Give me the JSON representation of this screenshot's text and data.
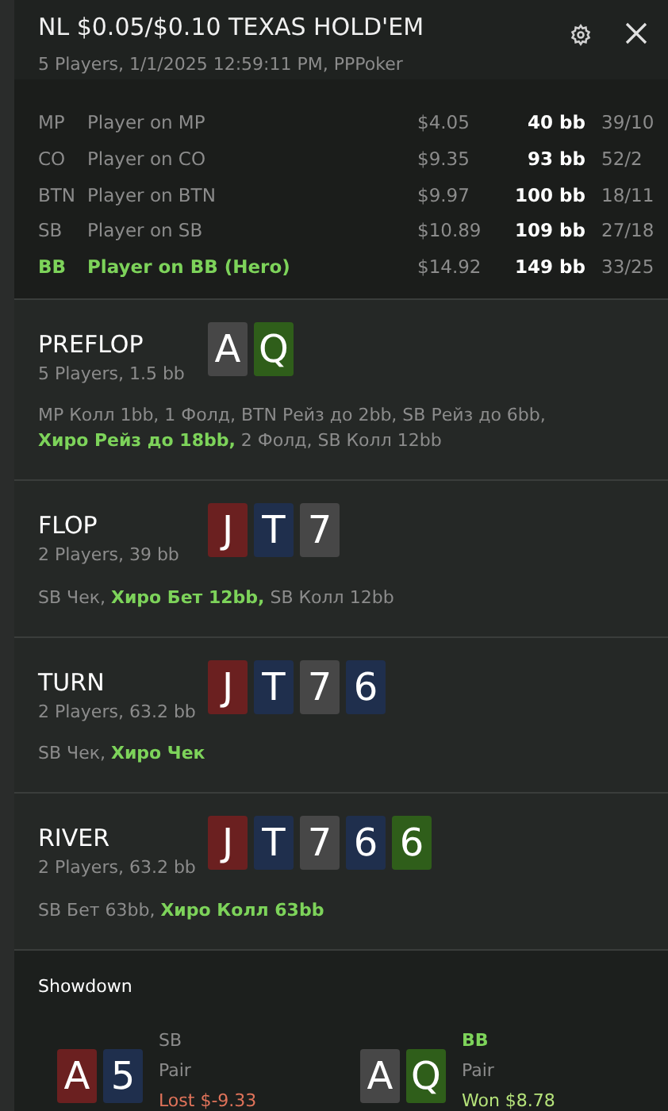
{
  "header": {
    "title": "NL $0.05/$0.10 TEXAS HOLD'EM",
    "subtitle": "5 Players, 1/1/2025 12:59:11 PM, PPPoker"
  },
  "players": [
    {
      "position": "MP",
      "name": "Player on MP",
      "stack": "$4.05",
      "bb": "40 bb",
      "stats": "39/10",
      "hero": false
    },
    {
      "position": "CO",
      "name": "Player on CO",
      "stack": "$9.35",
      "bb": "93 bb",
      "stats": "52/2",
      "hero": false
    },
    {
      "position": "BTN",
      "name": "Player on BTN",
      "stack": "$9.97",
      "bb": "100 bb",
      "stats": "18/11",
      "hero": false
    },
    {
      "position": "SB",
      "name": "Player on SB",
      "stack": "$10.89",
      "bb": "109 bb",
      "stats": "27/18",
      "hero": false
    },
    {
      "position": "BB",
      "name": "Player on BB (Hero)",
      "stack": "$14.92",
      "bb": "149 bb",
      "stats": "33/25",
      "hero": true
    }
  ],
  "streets": [
    {
      "name": "PREFLOP",
      "info": "5 Players, 1.5 bb",
      "cards": [
        {
          "rank": "A",
          "color": "#474747"
        },
        {
          "rank": "Q",
          "color": "#2f5e1a"
        }
      ],
      "actions": [
        {
          "text": "MP Колл 1bb, 1 Фолд, BTN Рейз до 2bb, SB Рейз до 6bb, ",
          "hero": false
        },
        {
          "text": "Хиро Рейз до 18bb,",
          "hero": true
        },
        {
          "text": " 2 Фолд, SB Колл 12bb",
          "hero": false
        }
      ]
    },
    {
      "name": "FLOP",
      "info": "2 Players, 39 bb",
      "cards": [
        {
          "rank": "J",
          "color": "#6b2020"
        },
        {
          "rank": "T",
          "color": "#1f2f4d"
        },
        {
          "rank": "7",
          "color": "#474747"
        }
      ],
      "actions": [
        {
          "text": "SB Чек, ",
          "hero": false
        },
        {
          "text": "Хиро Бет 12bb,",
          "hero": true
        },
        {
          "text": " SB Колл 12bb",
          "hero": false
        }
      ]
    },
    {
      "name": "TURN",
      "info": "2 Players, 63.2 bb",
      "cards": [
        {
          "rank": "J",
          "color": "#6b2020"
        },
        {
          "rank": "T",
          "color": "#1f2f4d"
        },
        {
          "rank": "7",
          "color": "#474747"
        },
        {
          "rank": "6",
          "color": "#1f2f4d"
        }
      ],
      "actions": [
        {
          "text": "SB Чек, ",
          "hero": false
        },
        {
          "text": "Хиро Чек",
          "hero": true
        }
      ]
    },
    {
      "name": "RIVER",
      "info": "2 Players, 63.2 bb",
      "cards": [
        {
          "rank": "J",
          "color": "#6b2020"
        },
        {
          "rank": "T",
          "color": "#1f2f4d"
        },
        {
          "rank": "7",
          "color": "#474747"
        },
        {
          "rank": "6",
          "color": "#1f2f4d"
        },
        {
          "rank": "6",
          "color": "#2f5e1a"
        }
      ],
      "actions": [
        {
          "text": "SB Бет 63bb, ",
          "hero": false
        },
        {
          "text": "Хиро Колл 63bb",
          "hero": true
        }
      ]
    }
  ],
  "showdown": {
    "title": "Showdown",
    "hands": [
      {
        "position": "SB",
        "hero": false,
        "hand": "Pair",
        "result": "Lost $-9.33",
        "won": false,
        "cards": [
          {
            "rank": "A",
            "color": "#6b2020"
          },
          {
            "rank": "5",
            "color": "#1f2f4d"
          }
        ]
      },
      {
        "position": "BB",
        "hero": true,
        "hand": "Pair",
        "result": "Won $8.78",
        "won": true,
        "cards": [
          {
            "rank": "A",
            "color": "#474747"
          },
          {
            "rank": "Q",
            "color": "#2f5e1a"
          }
        ]
      }
    ]
  }
}
